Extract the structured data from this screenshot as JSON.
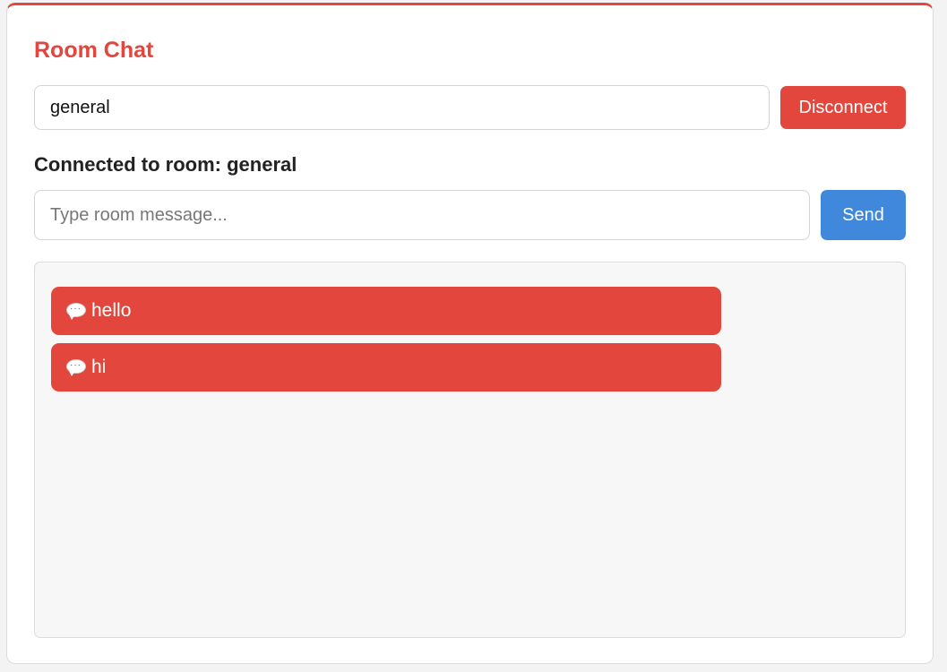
{
  "app": {
    "title": "Room Chat"
  },
  "room": {
    "input_value": "general",
    "disconnect_label": "Disconnect",
    "status_text": "Connected to room: general"
  },
  "composer": {
    "placeholder": "Type room message...",
    "send_label": "Send"
  },
  "messages": [
    {
      "icon": "speech-bubble-icon",
      "text": "hello"
    },
    {
      "icon": "speech-bubble-icon",
      "text": "hi"
    }
  ],
  "colors": {
    "accent": "#e2463c",
    "send": "#3f88dc"
  }
}
